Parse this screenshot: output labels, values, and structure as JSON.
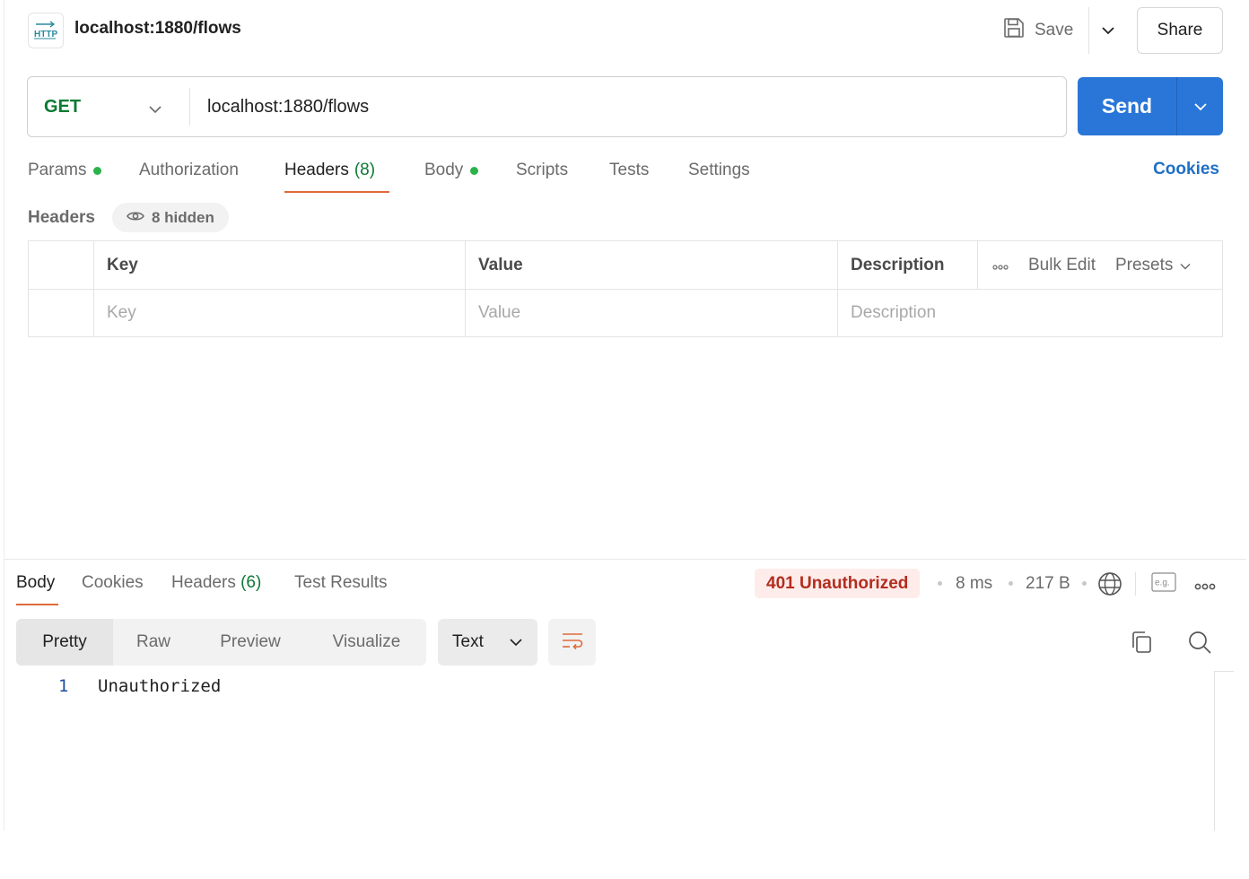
{
  "request": {
    "badge_icon": "http-icon",
    "title": "localhost:1880/flows",
    "save_label": "Save",
    "share_label": "Share",
    "method": "GET",
    "url": "localhost:1880/flows",
    "send_label": "Send"
  },
  "request_tabs": {
    "params": "Params",
    "authorization": "Authorization",
    "headers": "Headers",
    "headers_count": "(8)",
    "body": "Body",
    "scripts": "Scripts",
    "tests": "Tests",
    "settings": "Settings",
    "cookies": "Cookies",
    "active": "Headers",
    "dot_color": "#2bb34a",
    "underline_color": "#e06a3a"
  },
  "headers_section": {
    "label": "Headers",
    "hidden_label": "8 hidden",
    "columns": {
      "key": "Key",
      "value": "Value",
      "description": "Description"
    },
    "tools": {
      "bulk_edit": "Bulk Edit",
      "presets": "Presets"
    },
    "placeholders": {
      "key": "Key",
      "value": "Value",
      "description": "Description"
    }
  },
  "response": {
    "tabs": {
      "body": "Body",
      "cookies": "Cookies",
      "headers": "Headers",
      "headers_count": "(6)",
      "test_results": "Test Results"
    },
    "active_tab": "Body",
    "status": "401 Unauthorized",
    "status_color": "#b32d1e",
    "time": "8 ms",
    "size": "217 B",
    "views": {
      "pretty": "Pretty",
      "raw": "Raw",
      "preview": "Preview",
      "visualize": "Visualize"
    },
    "active_view": "Pretty",
    "format": "Text",
    "body_lines": [
      {
        "number": "1",
        "text": "Unauthorized"
      }
    ]
  },
  "colors": {
    "accent_blue": "#2a76d8",
    "method_green": "#0b7a33",
    "link_blue": "#1f6fc5"
  }
}
